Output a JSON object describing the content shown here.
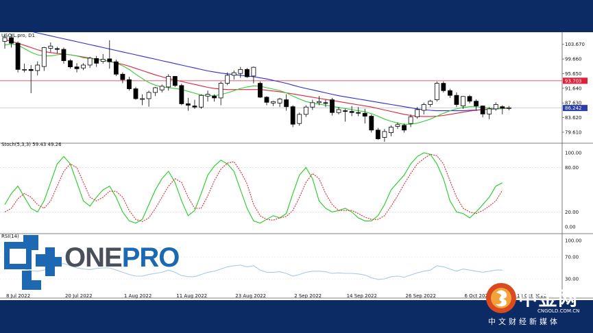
{
  "chart_data": {
    "type": "candlestick",
    "symbol_label": "USOIL.pro, D1",
    "x_tick_labels": [
      "8 Jul 2022",
      "20 Jul 2022",
      "1 Aug 2022",
      "11 Aug 2022",
      "23 Aug 2022",
      "2 Sep 2022",
      "14 Sep 2022",
      "26 Sep 2022",
      "6 Oct 2022",
      "18 Oct 2022"
    ],
    "price": {
      "y_ticks": [
        "103.670",
        "99.660",
        "95.650",
        "91.640",
        "87.630",
        "83.620",
        "79.610"
      ],
      "ylim": [
        76.6,
        107.0
      ],
      "horizontal_line_label": "93.703",
      "horizontal_line_value": 93.703,
      "last_price_label": "86.242",
      "last_price_value": 86.242,
      "candles": [
        {
          "o": 104.5,
          "h": 106.2,
          "l": 102.5,
          "c": 105.5
        },
        {
          "o": 105.5,
          "h": 106.5,
          "l": 102.8,
          "c": 104.0
        },
        {
          "o": 104.0,
          "h": 104.5,
          "l": 96.0,
          "c": 96.8
        },
        {
          "o": 96.8,
          "h": 98.4,
          "l": 96.0,
          "c": 96.8
        },
        {
          "o": 96.8,
          "h": 98.0,
          "l": 90.3,
          "c": 96.5
        },
        {
          "o": 96.5,
          "h": 99.0,
          "l": 95.2,
          "c": 98.0
        },
        {
          "o": 97.6,
          "h": 103.0,
          "l": 96.4,
          "c": 102.8
        },
        {
          "o": 102.6,
          "h": 104.2,
          "l": 101.5,
          "c": 103.2
        },
        {
          "o": 102.5,
          "h": 103.0,
          "l": 101.2,
          "c": 102.3
        },
        {
          "o": 102.3,
          "h": 102.8,
          "l": 98.4,
          "c": 99.2
        },
        {
          "o": 99.2,
          "h": 99.6,
          "l": 97.0,
          "c": 97.5
        },
        {
          "o": 97.5,
          "h": 98.5,
          "l": 96.0,
          "c": 97.0
        },
        {
          "o": 97.2,
          "h": 98.5,
          "l": 96.6,
          "c": 98.0
        },
        {
          "o": 98.0,
          "h": 100.3,
          "l": 97.2,
          "c": 99.9
        },
        {
          "o": 99.8,
          "h": 100.5,
          "l": 97.5,
          "c": 98.5
        },
        {
          "o": 99.0,
          "h": 101.0,
          "l": 98.4,
          "c": 99.6
        },
        {
          "o": 99.7,
          "h": 104.8,
          "l": 97.0,
          "c": 98.9
        },
        {
          "o": 98.9,
          "h": 99.5,
          "l": 95.0,
          "c": 95.5
        },
        {
          "o": 95.5,
          "h": 96.0,
          "l": 93.0,
          "c": 94.0
        },
        {
          "o": 94.0,
          "h": 94.8,
          "l": 91.0,
          "c": 91.5
        },
        {
          "o": 91.5,
          "h": 92.0,
          "l": 88.5,
          "c": 88.8
        },
        {
          "o": 88.6,
          "h": 90.0,
          "l": 87.0,
          "c": 88.8
        },
        {
          "o": 88.8,
          "h": 91.0,
          "l": 86.6,
          "c": 90.5
        },
        {
          "o": 90.5,
          "h": 92.0,
          "l": 89.5,
          "c": 91.8
        },
        {
          "o": 91.2,
          "h": 92.7,
          "l": 90.5,
          "c": 92.2
        },
        {
          "o": 92.0,
          "h": 95.5,
          "l": 91.0,
          "c": 94.9
        },
        {
          "o": 94.9,
          "h": 95.0,
          "l": 92.0,
          "c": 92.4
        },
        {
          "o": 92.4,
          "h": 92.9,
          "l": 87.0,
          "c": 87.4
        },
        {
          "o": 87.4,
          "h": 89.0,
          "l": 85.5,
          "c": 87.0
        },
        {
          "o": 86.8,
          "h": 88.5,
          "l": 86.0,
          "c": 86.5
        },
        {
          "o": 86.5,
          "h": 90.0,
          "l": 86.0,
          "c": 89.7
        },
        {
          "o": 89.5,
          "h": 91.0,
          "l": 88.0,
          "c": 90.0
        },
        {
          "o": 89.5,
          "h": 90.0,
          "l": 88.0,
          "c": 89.0
        },
        {
          "o": 89.0,
          "h": 93.5,
          "l": 87.0,
          "c": 93.0
        },
        {
          "o": 93.0,
          "h": 96.0,
          "l": 92.5,
          "c": 95.2
        },
        {
          "o": 95.2,
          "h": 96.5,
          "l": 94.0,
          "c": 95.9
        },
        {
          "o": 95.7,
          "h": 97.5,
          "l": 94.5,
          "c": 96.8
        },
        {
          "o": 96.8,
          "h": 97.2,
          "l": 94.5,
          "c": 94.8
        },
        {
          "o": 95.0,
          "h": 97.6,
          "l": 93.0,
          "c": 97.4
        },
        {
          "o": 93.0,
          "h": 93.5,
          "l": 89.0,
          "c": 89.2
        },
        {
          "o": 89.2,
          "h": 89.5,
          "l": 87.0,
          "c": 87.8
        },
        {
          "o": 87.6,
          "h": 88.2,
          "l": 86.8,
          "c": 88.0
        },
        {
          "o": 87.6,
          "h": 89.0,
          "l": 86.5,
          "c": 88.7
        },
        {
          "o": 88.5,
          "h": 90.0,
          "l": 85.5,
          "c": 86.6
        },
        {
          "o": 86.6,
          "h": 87.0,
          "l": 81.0,
          "c": 81.8
        },
        {
          "o": 82.0,
          "h": 85.0,
          "l": 81.4,
          "c": 84.5
        },
        {
          "o": 84.5,
          "h": 87.0,
          "l": 83.8,
          "c": 86.5
        },
        {
          "o": 86.5,
          "h": 88.5,
          "l": 85.7,
          "c": 87.7
        },
        {
          "o": 87.7,
          "h": 89.5,
          "l": 87.0,
          "c": 88.0
        },
        {
          "o": 87.7,
          "h": 88.5,
          "l": 86.5,
          "c": 87.6
        },
        {
          "o": 88.5,
          "h": 89.0,
          "l": 84.2,
          "c": 85.0
        },
        {
          "o": 85.0,
          "h": 86.5,
          "l": 84.5,
          "c": 85.8
        },
        {
          "o": 85.5,
          "h": 86.0,
          "l": 82.5,
          "c": 85.3
        },
        {
          "o": 85.3,
          "h": 86.8,
          "l": 84.0,
          "c": 85.0
        },
        {
          "o": 85.0,
          "h": 86.5,
          "l": 84.0,
          "c": 84.8
        },
        {
          "o": 84.8,
          "h": 86.0,
          "l": 82.0,
          "c": 84.0
        },
        {
          "o": 84.0,
          "h": 84.5,
          "l": 79.5,
          "c": 80.2
        },
        {
          "o": 80.2,
          "h": 80.8,
          "l": 77.5,
          "c": 77.8
        },
        {
          "o": 78.2,
          "h": 80.5,
          "l": 77.0,
          "c": 79.8
        },
        {
          "o": 79.5,
          "h": 81.5,
          "l": 78.5,
          "c": 81.0
        },
        {
          "o": 81.2,
          "h": 82.3,
          "l": 80.5,
          "c": 81.7
        },
        {
          "o": 81.5,
          "h": 82.0,
          "l": 79.5,
          "c": 80.2
        },
        {
          "o": 82.0,
          "h": 84.5,
          "l": 81.0,
          "c": 83.8
        },
        {
          "o": 83.8,
          "h": 86.5,
          "l": 83.3,
          "c": 85.8
        },
        {
          "o": 85.6,
          "h": 87.7,
          "l": 84.5,
          "c": 87.2
        },
        {
          "o": 87.2,
          "h": 88.5,
          "l": 86.5,
          "c": 88.1
        },
        {
          "o": 88.5,
          "h": 93.5,
          "l": 88.0,
          "c": 93.0
        },
        {
          "o": 93.0,
          "h": 93.5,
          "l": 90.5,
          "c": 91.0
        },
        {
          "o": 91.0,
          "h": 91.5,
          "l": 89.0,
          "c": 89.7
        },
        {
          "o": 89.7,
          "h": 90.5,
          "l": 86.5,
          "c": 87.2
        },
        {
          "o": 86.8,
          "h": 89.5,
          "l": 86.0,
          "c": 89.4
        },
        {
          "o": 89.4,
          "h": 89.8,
          "l": 87.5,
          "c": 88.1
        },
        {
          "o": 88.1,
          "h": 88.6,
          "l": 85.5,
          "c": 86.8
        },
        {
          "o": 86.8,
          "h": 86.9,
          "l": 83.7,
          "c": 84.6
        },
        {
          "o": 84.6,
          "h": 86.5,
          "l": 83.2,
          "c": 86.0
        },
        {
          "o": 86.0,
          "h": 87.8,
          "l": 85.5,
          "c": 87.2
        },
        {
          "o": 86.6,
          "h": 87.0,
          "l": 84.5,
          "c": 86.2
        },
        {
          "o": 86.2,
          "h": 86.8,
          "l": 85.6,
          "c": 86.3
        }
      ],
      "ma_green": [
        103.5,
        103.8,
        103.5,
        102.5,
        101.5,
        100.8,
        100.5,
        100.5,
        100.8,
        101.0,
        100.8,
        100.5,
        100.0,
        99.8,
        99.6,
        99.3,
        99.0,
        98.5,
        97.8,
        96.8,
        95.5,
        94.3,
        93.2,
        92.5,
        92.0,
        91.8,
        91.6,
        91.3,
        90.8,
        90.3,
        89.8,
        89.6,
        89.6,
        89.9,
        90.4,
        91.0,
        91.6,
        92.0,
        92.3,
        92.2,
        91.8,
        91.4,
        91.0,
        90.4,
        89.5,
        88.7,
        88.0,
        87.6,
        87.3,
        87.0,
        86.7,
        86.4,
        86.1,
        85.8,
        85.5,
        85.2,
        84.7,
        84.0,
        83.2,
        82.6,
        82.1,
        81.8,
        81.8,
        82.1,
        82.6,
        83.2,
        84.0,
        84.8,
        85.5,
        86.0,
        86.4,
        86.6,
        86.6,
        86.4,
        86.2,
        86.1,
        86.1,
        86.2
      ],
      "ma_red": [
        105.0,
        104.5,
        104.0,
        103.4,
        102.8,
        102.2,
        101.7,
        101.4,
        101.2,
        101.0,
        100.8,
        100.5,
        100.2,
        99.9,
        99.6,
        99.3,
        99.0,
        98.6,
        98.2,
        97.7,
        97.1,
        96.5,
        95.9,
        95.3,
        94.8,
        94.3,
        93.9,
        93.5,
        93.1,
        92.7,
        92.3,
        91.9,
        91.6,
        91.4,
        91.3,
        91.3,
        91.3,
        91.3,
        91.3,
        91.3,
        91.1,
        90.9,
        90.7,
        90.4,
        90.1,
        89.8,
        89.5,
        89.2,
        88.9,
        88.6,
        88.3,
        88.0,
        87.7,
        87.4,
        87.1,
        86.8,
        86.5,
        86.1,
        85.7,
        85.3,
        84.9,
        84.5,
        84.2,
        84.0,
        83.9,
        83.9,
        84.0,
        84.2,
        84.5,
        84.8,
        85.1,
        85.4,
        85.6,
        85.8,
        86.0,
        86.1,
        86.2,
        86.3
      ],
      "ma_blue": [
        108.5,
        108.2,
        107.9,
        107.6,
        107.2,
        106.8,
        106.4,
        106.0,
        105.6,
        105.2,
        104.8,
        104.4,
        104.0,
        103.6,
        103.2,
        102.8,
        102.4,
        102.0,
        101.6,
        101.2,
        100.8,
        100.4,
        100.0,
        99.6,
        99.2,
        98.8,
        98.4,
        98.0,
        97.6,
        97.2,
        96.8,
        96.4,
        96.1,
        95.8,
        95.6,
        95.4,
        95.2,
        95.0,
        94.8,
        94.5,
        94.2,
        93.8,
        93.4,
        93.0,
        92.5,
        92.0,
        91.6,
        91.2,
        90.8,
        90.4,
        90.0,
        89.6,
        89.3,
        89.0,
        88.7,
        88.4,
        88.1,
        87.8,
        87.5,
        87.2,
        86.9,
        86.6,
        86.3,
        86.0,
        85.8,
        85.6,
        85.5,
        85.5,
        85.5,
        85.5,
        85.5,
        85.6,
        85.7,
        85.8,
        85.9,
        86.0,
        86.1,
        86.2
      ]
    },
    "stochastic": {
      "label": "Stoch(5,3,3) 59.43 49.26",
      "y_ticks": [
        "100.00",
        "80.00",
        "20.00",
        "0.00"
      ],
      "ylim": [
        0,
        100
      ],
      "main_green": [
        30,
        45,
        55,
        40,
        25,
        20,
        35,
        60,
        85,
        95,
        85,
        60,
        35,
        28,
        40,
        50,
        55,
        40,
        20,
        8,
        5,
        10,
        30,
        50,
        65,
        75,
        60,
        35,
        15,
        22,
        45,
        70,
        82,
        90,
        85,
        75,
        50,
        25,
        8,
        5,
        10,
        15,
        12,
        18,
        45,
        70,
        80,
        65,
        35,
        25,
        20,
        22,
        25,
        20,
        12,
        8,
        8,
        15,
        30,
        50,
        60,
        70,
        85,
        95,
        100,
        98,
        85,
        65,
        35,
        20,
        18,
        12,
        20,
        30,
        40,
        55,
        59.43
      ],
      "signal_red": [
        20,
        25,
        38,
        45,
        40,
        30,
        25,
        35,
        55,
        75,
        85,
        80,
        60,
        40,
        35,
        40,
        48,
        48,
        40,
        22,
        10,
        7,
        12,
        25,
        40,
        55,
        65,
        60,
        40,
        25,
        25,
        42,
        62,
        78,
        86,
        88,
        75,
        58,
        30,
        15,
        10,
        9,
        12,
        14,
        22,
        40,
        60,
        72,
        65,
        45,
        30,
        22,
        22,
        22,
        18,
        13,
        10,
        10,
        15,
        28,
        42,
        58,
        72,
        85,
        92,
        98,
        96,
        85,
        62,
        40,
        25,
        20,
        18,
        22,
        28,
        35,
        49.26
      ]
    },
    "rsi": {
      "label": "RSI(14)",
      "y_ticks": [
        "100.00",
        "70.00",
        "30.00"
      ],
      "ylim": [
        0,
        100
      ],
      "values": [
        52,
        55,
        50,
        48,
        45,
        44,
        46,
        52,
        56,
        58,
        54,
        50,
        48,
        47,
        49,
        50,
        50,
        46,
        42,
        38,
        35,
        35,
        38,
        40,
        42,
        46,
        42,
        36,
        34,
        34,
        38,
        42,
        44,
        48,
        52,
        54,
        55,
        52,
        54,
        46,
        42,
        42,
        43,
        40,
        35,
        38,
        42,
        44,
        44,
        43,
        40,
        41,
        40,
        40,
        39,
        37,
        32,
        29,
        30,
        34,
        35,
        33,
        37,
        41,
        44,
        46,
        54,
        52,
        48,
        44,
        48,
        46,
        44,
        42,
        44,
        46,
        46
      ]
    }
  },
  "branding": {
    "logo_word_one": "ONE",
    "logo_word_pro": "PRO",
    "logo_colors": {
      "one": "#4a4f5c",
      "pro": "#1d68b3",
      "mark": "#1d68b3"
    },
    "watermark_cn": "中金网",
    "watermark_domain": "CNGOLD.COM.CN",
    "watermark_sub": "中文财经新媒体"
  },
  "colors": {
    "background_band": "#0c2a63",
    "bull_candle": "#ffffff",
    "bear_candle": "#000000",
    "ma_green": "#33cc33",
    "ma_red": "#e0203a",
    "ma_blue": "#2a2ad8",
    "h_line": "#e0203a",
    "last_price_box": "#2a3fa8",
    "stoch_main": "#22cc22",
    "stoch_signal": "#e0202a",
    "rsi_line": "#a8c8ec"
  }
}
